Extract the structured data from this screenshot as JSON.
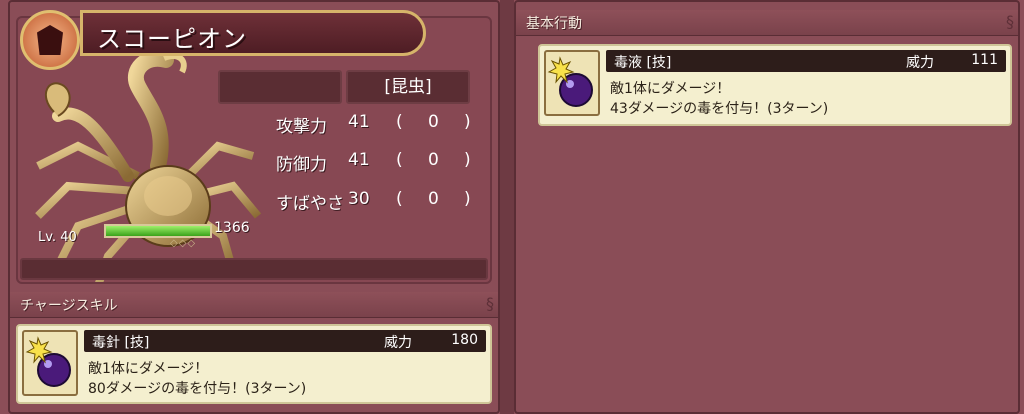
{
  "monster": {
    "name": "スコーピオン",
    "type": "[昆虫]",
    "level": "Lv. 40",
    "hp": "1366",
    "hp_fraction": 1.0,
    "stats": [
      {
        "label": "攻撃力",
        "value": "41",
        "open": "(",
        "bonus": "0",
        "close": ")"
      },
      {
        "label": "防御力",
        "value": "41",
        "open": "(",
        "bonus": "0",
        "close": ")"
      },
      {
        "label": "すばやさ",
        "value": "30",
        "open": "(",
        "bonus": "0",
        "close": ")"
      }
    ],
    "diamonds": "◇◇◇"
  },
  "charge_skill": {
    "header": "チャージスキル",
    "name": "毒針 [技]",
    "power_label": "威力",
    "power": "180",
    "desc1": "敵1体にダメージ！",
    "desc2": "80ダメージの毒を付与！(3ターン)",
    "icon": "poison-bomb-icon"
  },
  "basic_action": {
    "header": "基本行動",
    "name": "毒液 [技]",
    "power_label": "威力",
    "power": "111",
    "desc1": "敵1体にダメージ！",
    "desc2": "43ダメージの毒を付与！(3ターン)",
    "icon": "poison-bomb-icon"
  },
  "colors": {
    "panel_bg": "#8a4d57",
    "name_border": "#d6b46a",
    "hp_fill": "#5ccf2e",
    "skill_bg": "#f4efcf"
  }
}
